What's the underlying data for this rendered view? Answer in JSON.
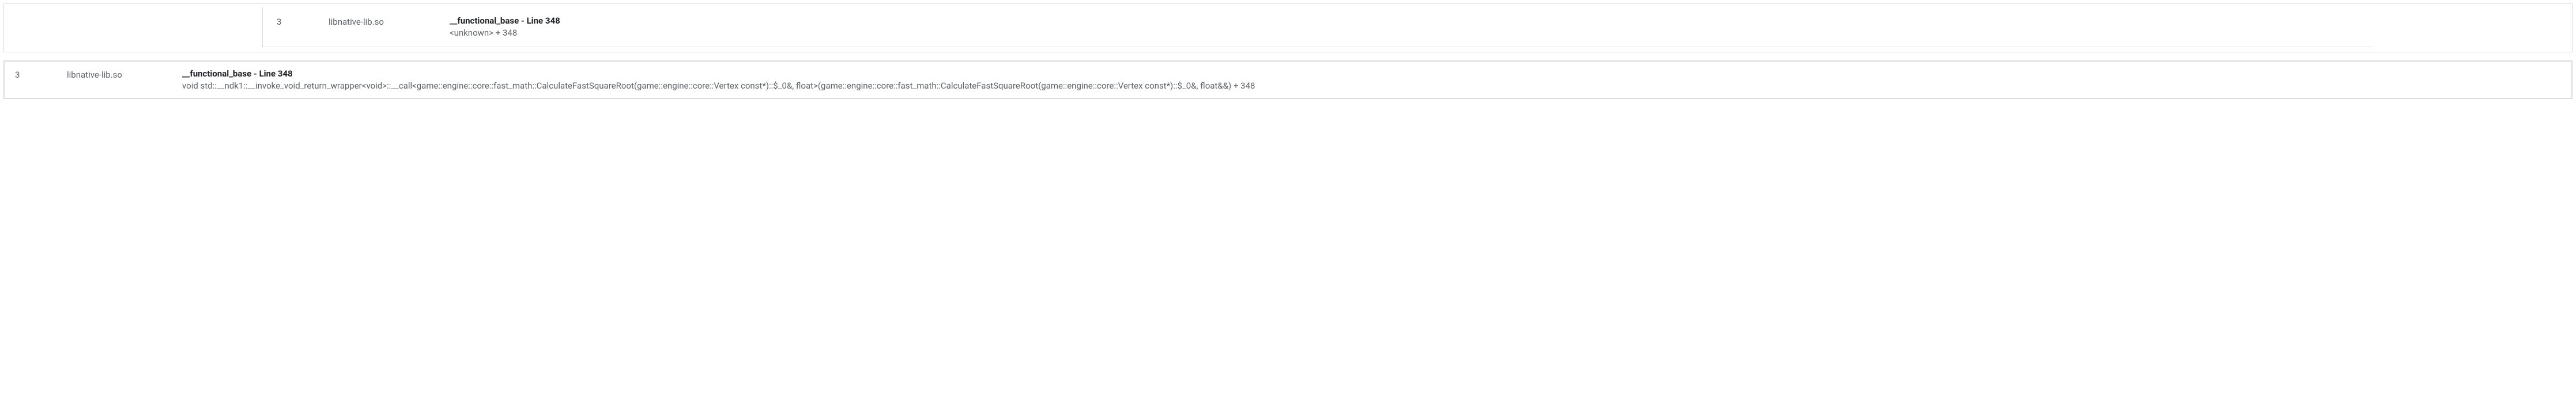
{
  "frames": {
    "top": {
      "index": "3",
      "lib": "libnative-lib.so",
      "title": "__functional_base - Line 348",
      "sub": "<unknown> + 348"
    },
    "bottom": {
      "index": "3",
      "lib": "libnative-lib.so",
      "title": "__functional_base - Line 348",
      "sub": "void std::__ndk1::__invoke_void_return_wrapper<void>::__call<game::engine::core::fast_math::CalculateFastSquareRoot(game::engine::core::Vertex const*)::$_0&, float>(game::engine::core::fast_math::CalculateFastSquareRoot(game::engine::core::Vertex const*)::$_0&, float&&) + 348"
    }
  }
}
